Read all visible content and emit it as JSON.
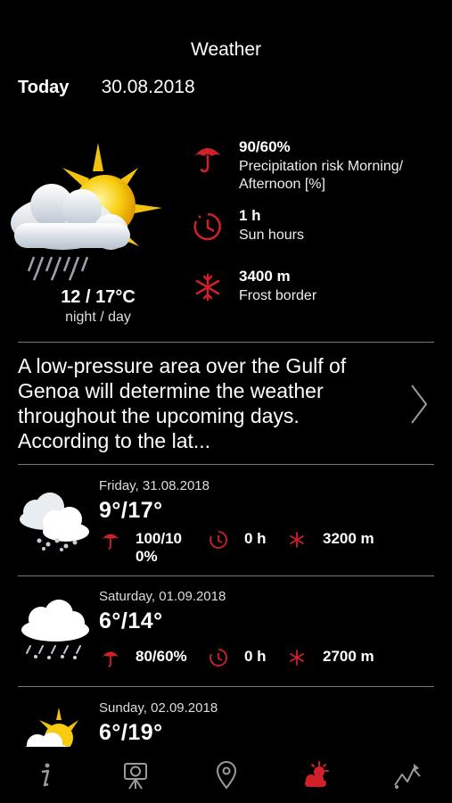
{
  "header": {
    "title": "Weather"
  },
  "today": {
    "label": "Today",
    "date": "30.08.2018",
    "temp": "12 / 17°C",
    "temp_caption": "night / day",
    "precipitation": {
      "value": "90/60%",
      "label": "Precipitation risk Morning/ Afternoon [%]",
      "icon": "umbrella-icon"
    },
    "sun": {
      "value": "1 h",
      "label": "Sun hours",
      "icon": "clock-icon"
    },
    "frost": {
      "value": "3400 m",
      "label": "Frost border",
      "icon": "snowflake-icon"
    }
  },
  "summary": {
    "text": "A low-pressure area over the Gulf of Genoa will determine the weather throughout the upcoming days. According to the lat..."
  },
  "forecast": [
    {
      "date": "Friday, 31.08.2018",
      "temp": "9°/17°",
      "precip_line1": "100/10",
      "precip_line2": "0%",
      "sun": "0 h",
      "frost": "3200 m",
      "icon": "rain-cloud-icon"
    },
    {
      "date": "Saturday, 01.09.2018",
      "temp": "6°/14°",
      "precip": "80/60%",
      "sun": "0 h",
      "frost": "2700 m",
      "icon": "rain-cloud-icon"
    },
    {
      "date": "Sunday, 02.09.2018",
      "temp": "6°/19°",
      "icon": "sun-cloud-icon"
    }
  ],
  "tabbar": [
    {
      "name": "info",
      "icon": "info-icon",
      "active": false
    },
    {
      "name": "webcam",
      "icon": "camera-icon",
      "active": false
    },
    {
      "name": "map",
      "icon": "location-pin-icon",
      "active": false
    },
    {
      "name": "weather",
      "icon": "weather-icon",
      "active": true
    },
    {
      "name": "trail",
      "icon": "route-icon",
      "active": false
    }
  ],
  "colors": {
    "accent": "#d0202a",
    "background": "#000000",
    "text": "#ffffff",
    "divider": "#777777"
  }
}
